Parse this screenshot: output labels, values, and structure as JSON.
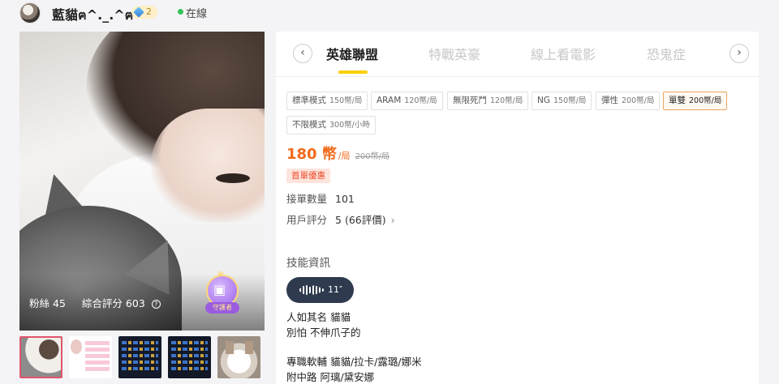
{
  "header": {
    "nickname": "藍貓ฅ^._.^ฅ",
    "level": "2",
    "status": "在線"
  },
  "photo": {
    "fans_label": "粉絲",
    "fans_count": "45",
    "score_label": "綜合評分",
    "score_value": "603",
    "badge_label": "守護者"
  },
  "thumbnails": [
    "photo-1",
    "photo-2",
    "photo-3",
    "photo-4",
    "photo-5"
  ],
  "tabs": [
    {
      "label": "英雄聯盟",
      "active": true
    },
    {
      "label": "特戰英豪",
      "active": false
    },
    {
      "label": "線上看電影",
      "active": false
    },
    {
      "label": "恐鬼症",
      "active": false
    }
  ],
  "modes": [
    {
      "name": "標準模式",
      "price": "150幣/局",
      "selected": false
    },
    {
      "name": "ARAM",
      "price": "120幣/局",
      "selected": false
    },
    {
      "name": "無限死鬥",
      "price": "120幣/局",
      "selected": false
    },
    {
      "name": "NG",
      "price": "150幣/局",
      "selected": false
    },
    {
      "name": "彈性",
      "price": "200幣/局",
      "selected": false
    },
    {
      "name": "單雙",
      "price": "200幣/局",
      "selected": true
    },
    {
      "name": "不限模式",
      "price": "300幣/小時",
      "selected": false
    }
  ],
  "pricing": {
    "current": "180 幣",
    "unit": "/局",
    "original": "200幣/局",
    "promo": "首單優惠"
  },
  "stats": {
    "orders_label": "接單數量",
    "orders_value": "101",
    "rating_label": "用戶評分",
    "rating_value": "5 (66評價)"
  },
  "skills": {
    "title": "技能資訊",
    "voice_duration": "11″",
    "bio": [
      "人如其名 貓貓",
      "別怕 不伸爪子的",
      "專職軟輔 貓貓/拉卡/露璐/娜米",
      "附中路 阿璃/黛安娜"
    ]
  },
  "colors": {
    "accent_yellow": "#fbd000",
    "price_orange": "#f26a1b",
    "online_green": "#35c15a",
    "selected_border": "#f0a35d"
  }
}
